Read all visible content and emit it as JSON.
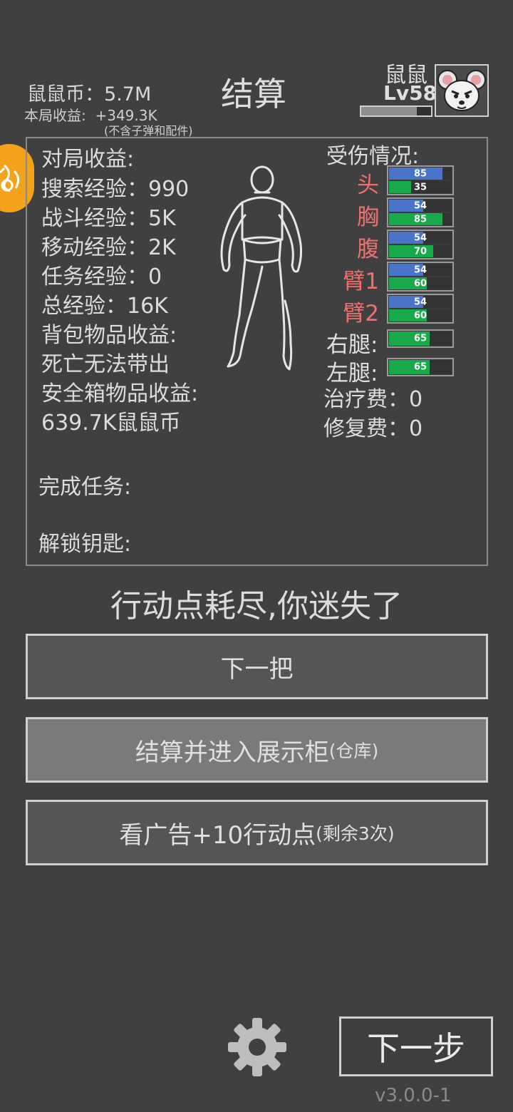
{
  "header": {
    "coin_label": "鼠鼠币：",
    "coin_value": "5.7M",
    "income_label": "本局收益:",
    "income_value": "+349.3K",
    "income_note": "(不含子弹和配件)",
    "title": "结算",
    "player_name": "鼠鼠",
    "player_level": "Lv58",
    "xp_progress": 0.8,
    "avatar_icon": "mouse-face-icon"
  },
  "side_badge": {
    "icon": "fire-swirl-icon",
    "color": "#f3a21c"
  },
  "summary": {
    "heading": "对局收益:",
    "search_exp": "搜索经验：990",
    "combat_exp": "战斗经验：5K",
    "move_exp": "移动经验：2K",
    "task_exp": "任务经验：0",
    "total_exp": "总经验：16K",
    "backpack_label": "背包物品收益:",
    "backpack_value": "死亡无法带出",
    "safebox_label": "安全箱物品收益:",
    "safebox_value": "639.7K鼠鼠币",
    "tasks_label": "完成任务:",
    "keys_label": "解锁钥匙:"
  },
  "injury": {
    "title": "受伤情况:",
    "parts": [
      {
        "name": "头",
        "armor": 85,
        "hp": 35
      },
      {
        "name": "胸",
        "armor": 54,
        "hp": 85
      },
      {
        "name": "腹",
        "armor": 54,
        "hp": 70
      },
      {
        "name": "臂1",
        "armor": 54,
        "hp": 60
      },
      {
        "name": "臂2",
        "armor": 54,
        "hp": 60
      }
    ],
    "legs": [
      {
        "name": "右腿:",
        "hp": 65
      },
      {
        "name": "左腿:",
        "hp": 65
      }
    ],
    "treatment_fee": "治疗费：0",
    "repair_fee": "修复费：0",
    "armor_color": "#4a74c9",
    "hp_color": "#18a94a"
  },
  "status_message": "行动点耗尽,你迷失了",
  "buttons": {
    "next_round": "下一把",
    "settle_main": "结算并进入展示柜",
    "settle_sub": "(仓库)",
    "ad_main": "看广告+10行动点",
    "ad_sub": "(剩余3次)"
  },
  "footer": {
    "settings_icon": "gear-icon",
    "next_step": "下一步",
    "version": "v3.0.0-1"
  }
}
